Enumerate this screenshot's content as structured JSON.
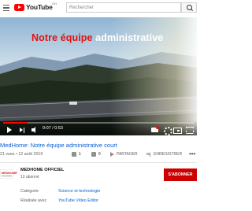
{
  "header": {
    "brand": "YouTube",
    "brand_region": "CH",
    "search_placeholder": "Rechercher"
  },
  "video": {
    "overlay_title_accent": "Notre équipe",
    "overlay_title_rest": " administrative",
    "time_display": "0:07 / 0:53",
    "progress_fraction": 0.13
  },
  "info": {
    "title": "MedHome: Notre équipe administrative court",
    "meta": "21 vues • 12 août 2019",
    "likes": "1",
    "dislikes": "0",
    "share_label": "PARTAGER",
    "save_label": "ENREGISTRER",
    "more_label": "•••"
  },
  "channel": {
    "avatar_text": "MEDHOME",
    "name": "MEDHOME OFFICIEL",
    "subscribers": "10 abonné",
    "subscribe_label": "S'ABONNER"
  },
  "details": [
    {
      "label": "Catégorie",
      "value": "Science et technologie"
    },
    {
      "label": "Réalisée avec",
      "value": "YouTube Video Editor"
    }
  ],
  "colors": {
    "accent_red": "#e11212",
    "link_blue": "#065fd4",
    "subscribe_red": "#cc0000"
  }
}
